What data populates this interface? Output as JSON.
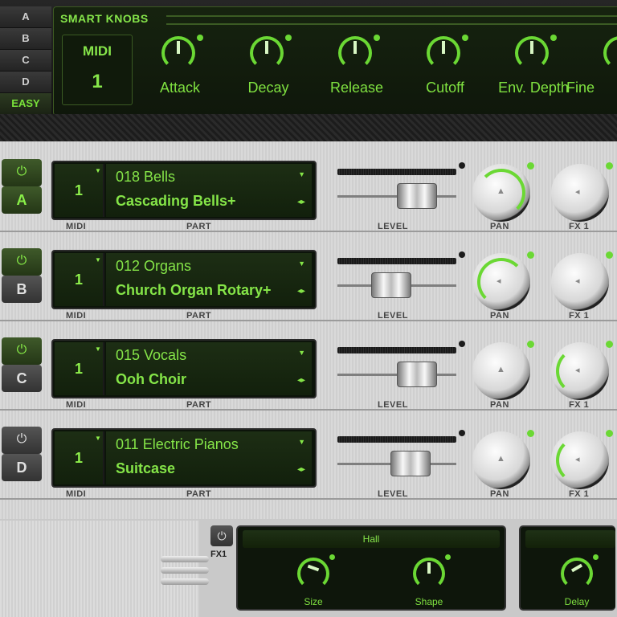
{
  "side_tabs": [
    "A",
    "B",
    "C",
    "D",
    "EASY"
  ],
  "smart_knobs": {
    "title": "SMART KNOBS",
    "midi_label": "MIDI",
    "midi_value": "1",
    "knobs": [
      "Attack",
      "Decay",
      "Release",
      "Cutoff",
      "Env. Depth",
      "Fine"
    ]
  },
  "parts": [
    {
      "letter": "A",
      "power_on": true,
      "midi": "1",
      "category": "018 Bells",
      "preset": "Cascading Bells+"
    },
    {
      "letter": "B",
      "power_on": true,
      "midi": "1",
      "category": "012 Organs",
      "preset": "Church Organ Rotary+"
    },
    {
      "letter": "C",
      "power_on": true,
      "midi": "1",
      "category": "015 Vocals",
      "preset": "Ooh Choir"
    },
    {
      "letter": "D",
      "power_on": false,
      "midi": "1",
      "category": "011 Electric Pianos",
      "preset": "Suitcase"
    }
  ],
  "labels": {
    "midi": "MIDI",
    "part": "PART",
    "level": "LEVEL",
    "pan": "PAN",
    "fx1": "FX 1"
  },
  "fx": {
    "power_label": "FX1",
    "panel1": {
      "title": "Hall",
      "knobs": [
        "Size",
        "Shape"
      ]
    },
    "panel2": {
      "title": "",
      "knobs": [
        "Delay"
      ]
    }
  },
  "colors": {
    "accent": "#6bd834",
    "lcd_bg": "#0c140a",
    "silver": "#d4d4d4"
  }
}
